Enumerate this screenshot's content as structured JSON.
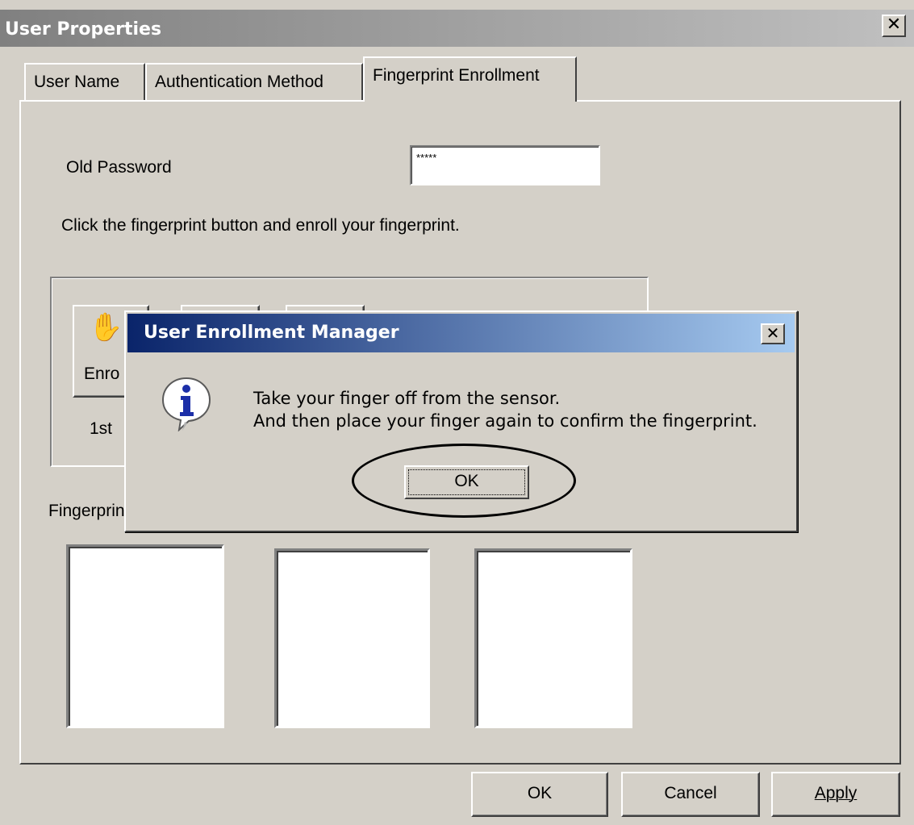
{
  "window": {
    "title": "User Properties",
    "close_glyph": "✕"
  },
  "tabs": [
    {
      "label": "User Name"
    },
    {
      "label": "Authentication Method"
    },
    {
      "label": "Fingerprint Enrollment"
    }
  ],
  "form": {
    "old_password_label": "Old Password",
    "old_password_value": "*****",
    "instruction": "Click the fingerprint button and enroll your fingerprint.",
    "enroll_button_partial": "Enro",
    "enroll_first_label": "1st",
    "fingerprint_label_partial": "Fingerprin"
  },
  "dialog": {
    "title": "User Enrollment Manager",
    "close_glyph": "✕",
    "message_line1": "Take your finger off from the sensor.",
    "message_line2": "And then place your finger again to confirm the fingerprint.",
    "ok_label": "OK",
    "icon": "info-icon"
  },
  "footer": {
    "ok_label": "OK",
    "cancel_label": "Cancel",
    "apply_label": "Apply"
  }
}
